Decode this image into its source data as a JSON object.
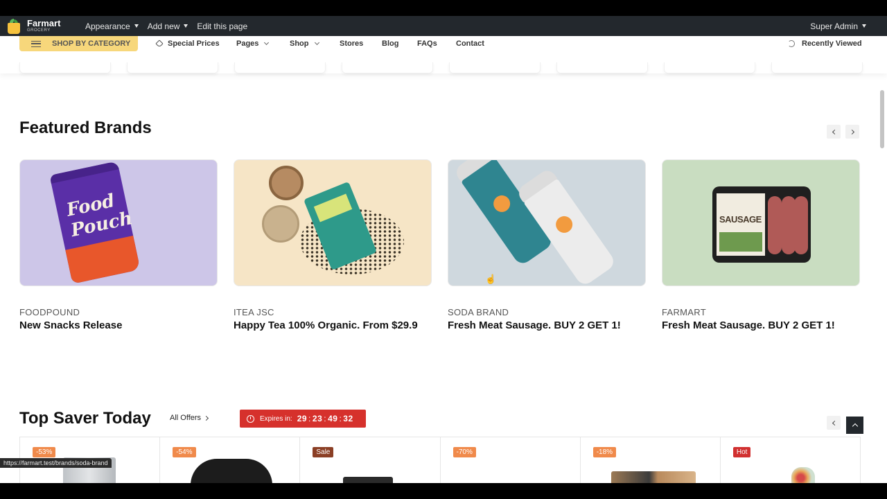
{
  "adminbar": {
    "brand_name": "Farmart",
    "brand_sub": "GROCERY",
    "items": [
      "Appearance",
      "Add new",
      "Edit this page"
    ],
    "user": "Super Admin"
  },
  "navbar": {
    "shop_by_category": "SHOP BY CATEGORY",
    "links": [
      "Special Prices",
      "Pages",
      "Shop",
      "Stores",
      "Blog",
      "FAQs",
      "Contact"
    ],
    "recently_viewed": "Recently Viewed"
  },
  "featured": {
    "title": "Featured Brands",
    "pouch_text": "Food Pouch",
    "brands": [
      {
        "name": "FOODPOUND",
        "title": "New Snacks Release"
      },
      {
        "name": "ITEA JSC",
        "title": "Happy Tea 100% Organic. From $29.9"
      },
      {
        "name": "SODA BRAND",
        "title": "Fresh Meat Sausage. BUY 2 GET 1!"
      },
      {
        "name": "FARMART",
        "title": "Fresh Meat Sausage. BUY 2 GET 1!"
      }
    ],
    "sausage_label": "SAUSAGE"
  },
  "top_saver": {
    "title": "Top Saver Today",
    "all_offers": "All Offers",
    "expires_label": "Expires in:",
    "countdown": [
      "29",
      "23",
      "49",
      "32"
    ],
    "badges": [
      "-53%",
      "-54%",
      "Sale",
      "-70%",
      "-18%",
      "Hot"
    ]
  },
  "status_url": "https://farmart.test/brands/soda-brand",
  "colors": {
    "accent": "#f7d77b",
    "timer": "#d6312c",
    "adminbar": "#23282d"
  }
}
